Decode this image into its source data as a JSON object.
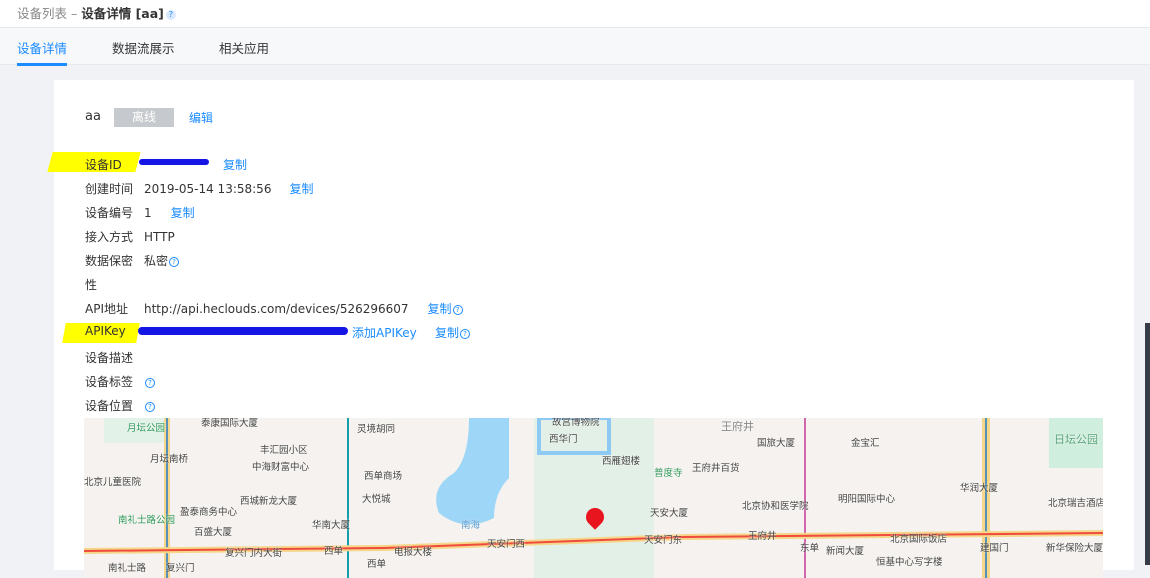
{
  "header": {
    "breadcrumb_parent": "设备列表",
    "separator": " – ",
    "breadcrumb_current": "设备详情 [aa]",
    "help": "?"
  },
  "tabs": [
    {
      "label": "设备详情",
      "active": true
    },
    {
      "label": "数据流展示"
    },
    {
      "label": "相关应用"
    }
  ],
  "device": {
    "name": "aa",
    "status": "离线",
    "edit": "编辑"
  },
  "fields": {
    "id": {
      "label": "设备ID",
      "copy": "复制"
    },
    "created": {
      "label": "创建时间",
      "value": "2019-05-14 13:58:56",
      "copy": "复制"
    },
    "number": {
      "label": "设备编号",
      "value": "1",
      "copy": "复制"
    },
    "access": {
      "label": "接入方式",
      "value": "HTTP"
    },
    "privacy": {
      "label": "数据保密",
      "label2": "性",
      "value": "私密"
    },
    "api": {
      "label": "API地址",
      "value": "http://api.heclouds.com/devices/526296607",
      "copy": "复制"
    },
    "apikey": {
      "label": "APIKey",
      "add": "添加APIKey",
      "copy": "复制"
    },
    "desc": {
      "label": "设备描述"
    },
    "tags": {
      "label": "设备标签"
    },
    "location": {
      "label": "设备位置"
    }
  },
  "help_glyph": "?",
  "map": {
    "labels": [
      "月坛公园",
      "泰康国际大厦",
      "丰汇园小区",
      "灵境胡同",
      "故宫博物院",
      "西华门",
      "月坛南桥",
      "中海财富中心",
      "西单商场",
      "西雁翅楼",
      "普度寺",
      "王府井百货",
      "北京儿童医院",
      "大悦城",
      "西城新龙大厦",
      "盈泰商务中心",
      "南礼士路公园",
      "百盛大厦",
      "华南大厦",
      "电报大楼",
      "南海",
      "天安门西",
      "天安门东",
      "王府井",
      "东单",
      "西单",
      "复兴门内大街",
      "南礼士路",
      "复兴门",
      "西单",
      "王府井",
      "国旅大厦",
      "金宝汇",
      "天安大厦",
      "北京协和医学院",
      "明阳国际中心",
      "北京国际饭店",
      "新闻大厦",
      "恒基中心写字楼",
      "华润大厦",
      "日坛公园",
      "北京瑞吉酒店",
      "建国门",
      "新华保险大厦"
    ]
  },
  "colors": {
    "accent": "#1a8cff",
    "offline": "#c6c9cd"
  }
}
